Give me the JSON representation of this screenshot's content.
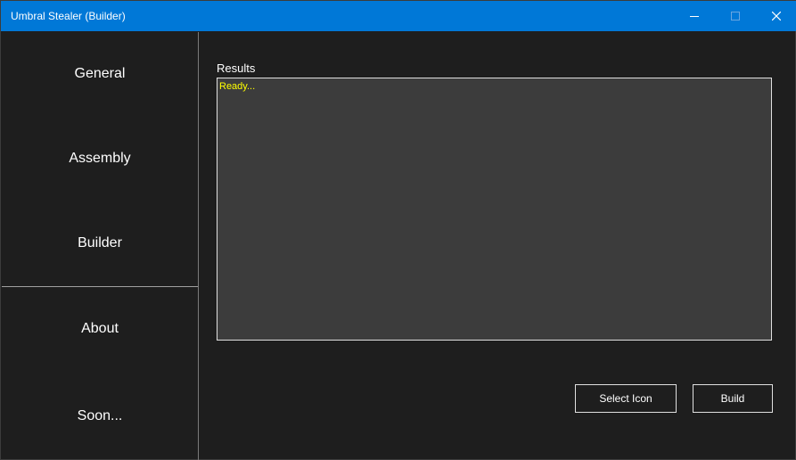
{
  "window": {
    "title": "Umbral Stealer (Builder)",
    "accent_color": "#0078d7"
  },
  "sidebar": {
    "items": [
      {
        "label": "General"
      },
      {
        "label": "Assembly"
      },
      {
        "label": "Builder"
      },
      {
        "label": "About"
      },
      {
        "label": "Soon..."
      }
    ]
  },
  "main": {
    "results_label": "Results",
    "results_text": "Ready...",
    "results_text_color": "#ffff00",
    "buttons": {
      "select_icon": "Select Icon",
      "build": "Build"
    }
  }
}
